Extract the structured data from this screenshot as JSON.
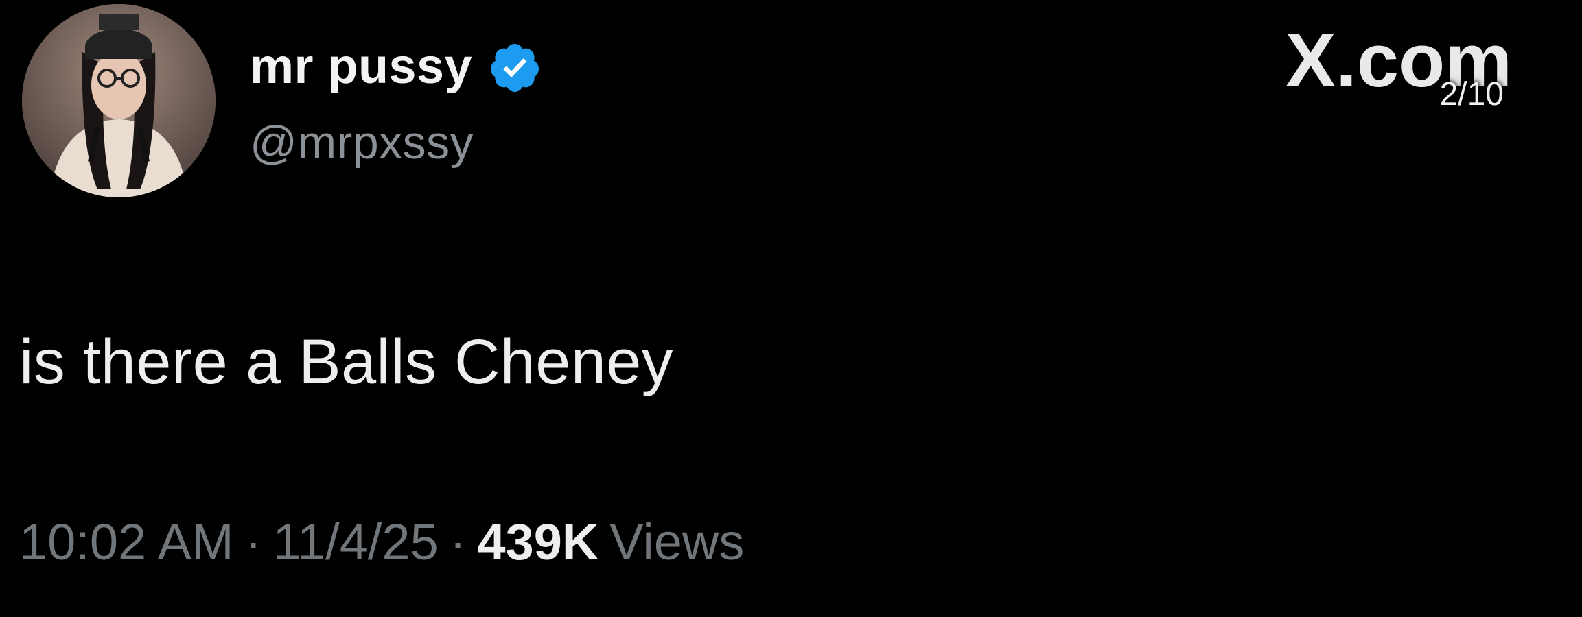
{
  "brand": {
    "text": "X.com",
    "page_indicator": "2/10"
  },
  "author": {
    "display_name": "mr pussy",
    "handle": "@mrpxssy",
    "verified": true,
    "badge_color": "#1d9bf0"
  },
  "tweet": {
    "text": "is there a Balls Cheney"
  },
  "meta": {
    "time": "10:02 AM",
    "separator": "·",
    "date": "11/4/25",
    "views_count": "439K",
    "views_label": "Views"
  },
  "colors": {
    "background": "#000000",
    "primary_text": "#e7e9ea",
    "secondary_text": "#71767b"
  }
}
